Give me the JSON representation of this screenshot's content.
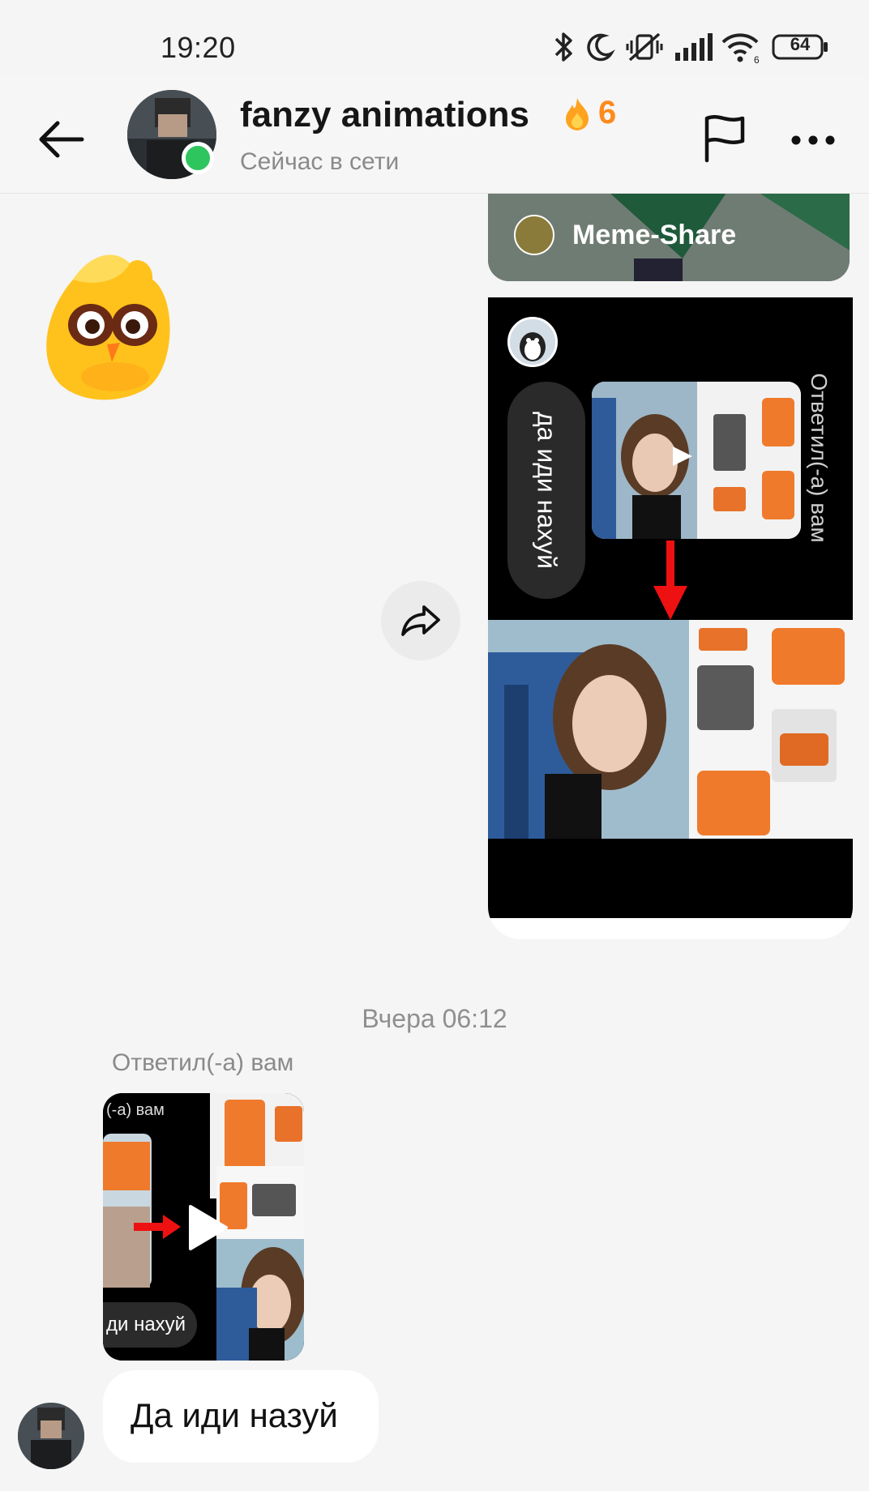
{
  "status_bar": {
    "time": "19:20",
    "battery": "64",
    "icons": [
      "bluetooth-icon",
      "moon-icon",
      "vibrate-off-icon",
      "signal-icon",
      "wifi-icon",
      "battery-icon"
    ]
  },
  "header": {
    "contact_name": "fanzy animations",
    "streak_count": "6",
    "presence": "Сейчас в сети",
    "icons": [
      "back-arrow-icon",
      "flag-icon",
      "more-icon"
    ]
  },
  "chat": {
    "shared_card_label": "Meme-Share",
    "video_reply_text": "да иди нахуй",
    "video_side_text": "Ответил(-а) вам",
    "date_divider": "Вчера 06:12",
    "replied_label": "Ответил(-а) вам",
    "reply_thumb_top_text": "(-а) вам",
    "reply_thumb_bottom_text": "ди нахуй",
    "message_text": "Да иди назуй"
  },
  "colors": {
    "accent_orange": "#ff8a1c",
    "online_green": "#2ec55e",
    "background": "#f5f5f5"
  }
}
